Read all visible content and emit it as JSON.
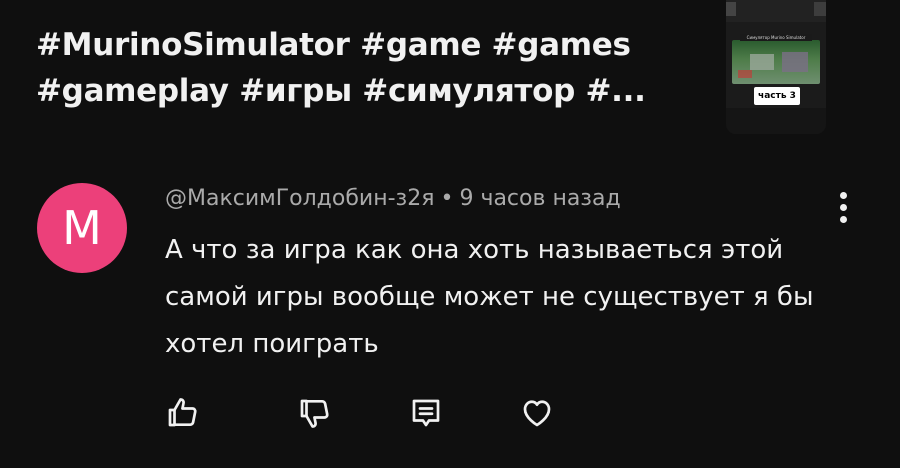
{
  "video": {
    "title": "#MurinoSimulator #game #games #gameplay #игры #симулятор #...",
    "thumbnail": {
      "banner_text": "Симулятор Murino Simulator",
      "label": "часть 3"
    }
  },
  "comment": {
    "avatar_letter": "M",
    "avatar_color": "#ec407a",
    "author": "@МаксимГолдобин-з2я",
    "separator": "•",
    "time": "9 часов назад",
    "text": "А что за игра как она хоть называеться этой самой игры вообще может не существует я бы хотел поиграть",
    "actions": {
      "like_icon": "thumbs-up-icon",
      "dislike_icon": "thumbs-down-icon",
      "reply_icon": "comment-icon",
      "heart_icon": "heart-icon"
    },
    "menu_icon": "more-vertical-icon"
  }
}
